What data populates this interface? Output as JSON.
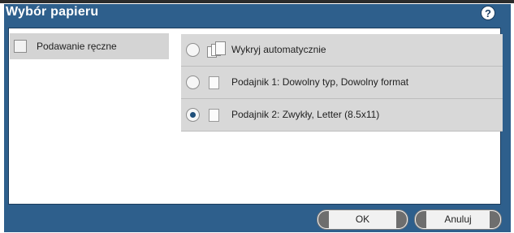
{
  "dialog": {
    "title": "Wybór papieru",
    "help_icon": "help-icon",
    "help_glyph": "?"
  },
  "manual_feed": {
    "label": "Podawanie ręczne",
    "checked": false
  },
  "options": [
    {
      "label": "Wykryj automatycznie",
      "selected": false,
      "icon": "paper-stack-icon"
    },
    {
      "label": "Podajnik 1: Dowolny typ, Dowolny format",
      "selected": false,
      "icon": "paper-icon"
    },
    {
      "label": "Podajnik 2: Zwykły, Letter (8.5x11)",
      "selected": true,
      "icon": "paper-icon"
    }
  ],
  "buttons": {
    "ok": "OK",
    "cancel": "Anuluj"
  },
  "colors": {
    "accent": "#2e5f8c",
    "row_bg": "#d8d8d8",
    "selected_dot": "#1f4f7a"
  }
}
